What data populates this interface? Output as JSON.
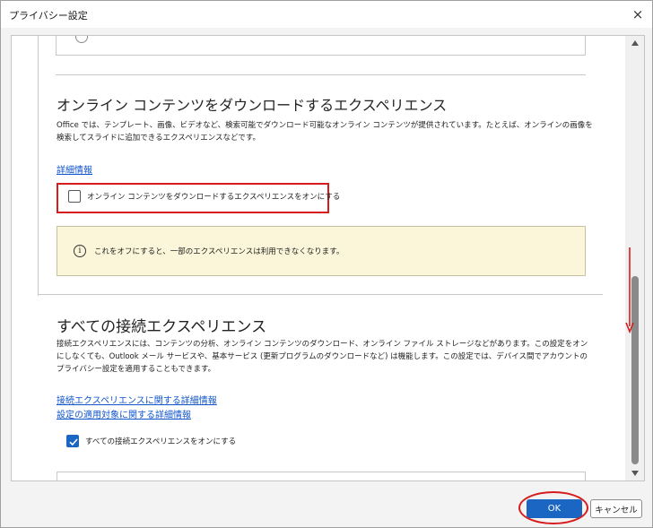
{
  "window": {
    "title": "プライバシー設定",
    "close_icon": "×"
  },
  "section1": {
    "title": "オンライン コンテンツをダウンロードするエクスペリエンス",
    "description": "Office では、テンプレート、画像、ビデオなど、検索可能でダウンロード可能なオンライン コンテンツが提供されています。たとえば、オンラインの画像を検索してスライドに追加できるエクスペリエンスなどです。",
    "link": "詳細情報",
    "checkbox_label": "オンライン コンテンツをダウンロードするエクスペリエンスをオンにする",
    "checkbox_checked": false,
    "info_icon": "i",
    "info_text": "これをオフにすると、一部のエクスペリエンスは利用できなくなります。"
  },
  "section2": {
    "title": "すべての接続エクスペリエンス",
    "description": "接続エクスペリエンスには、コンテンツの分析、オンライン コンテンツのダウンロード、オンライン ファイル ストレージなどがあります。この設定をオンにしなくても、Outlook メール サービスや、基本サービス (更新プログラムのダウンロードなど) は機能します。この設定では、デバイス間でアカウントのプライバシー設定を適用することもできます。",
    "link1": "接続エクスペリエンスに関する詳細情報",
    "link2": "設定の適用対象に関する詳細情報",
    "checkbox_label": "すべての接続エクスペリエンスをオンにする",
    "checkbox_checked": true
  },
  "buttons": {
    "ok": "OK",
    "cancel": "キャンセル"
  },
  "colors": {
    "accent": "#1a66c2",
    "annotation_red": "#d61c1c",
    "info_bg": "#fbf6d9"
  }
}
